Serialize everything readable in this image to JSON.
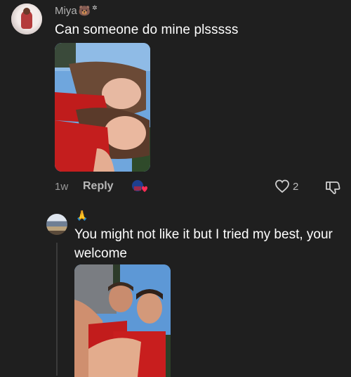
{
  "comment": {
    "username": "Miya",
    "username_emoji": "🐻",
    "username_sparkle": "✲",
    "text": "Can someone do mine plsssss",
    "time": "1w",
    "reply_label": "Reply",
    "like_count": "2",
    "icons": {
      "avatar": "user-avatar",
      "creator_like": "creator-liked-icon",
      "heart": "heart-outline-icon",
      "dislike": "thumbs-down-icon"
    }
  },
  "reply": {
    "emoji": "🙏",
    "text": "You might not like it but I tried my best, your welcome"
  },
  "colors": {
    "background": "#1f1f1f",
    "text": "#ffffff",
    "muted": "#9a9a9a",
    "accent_red": "#fe2c55"
  }
}
